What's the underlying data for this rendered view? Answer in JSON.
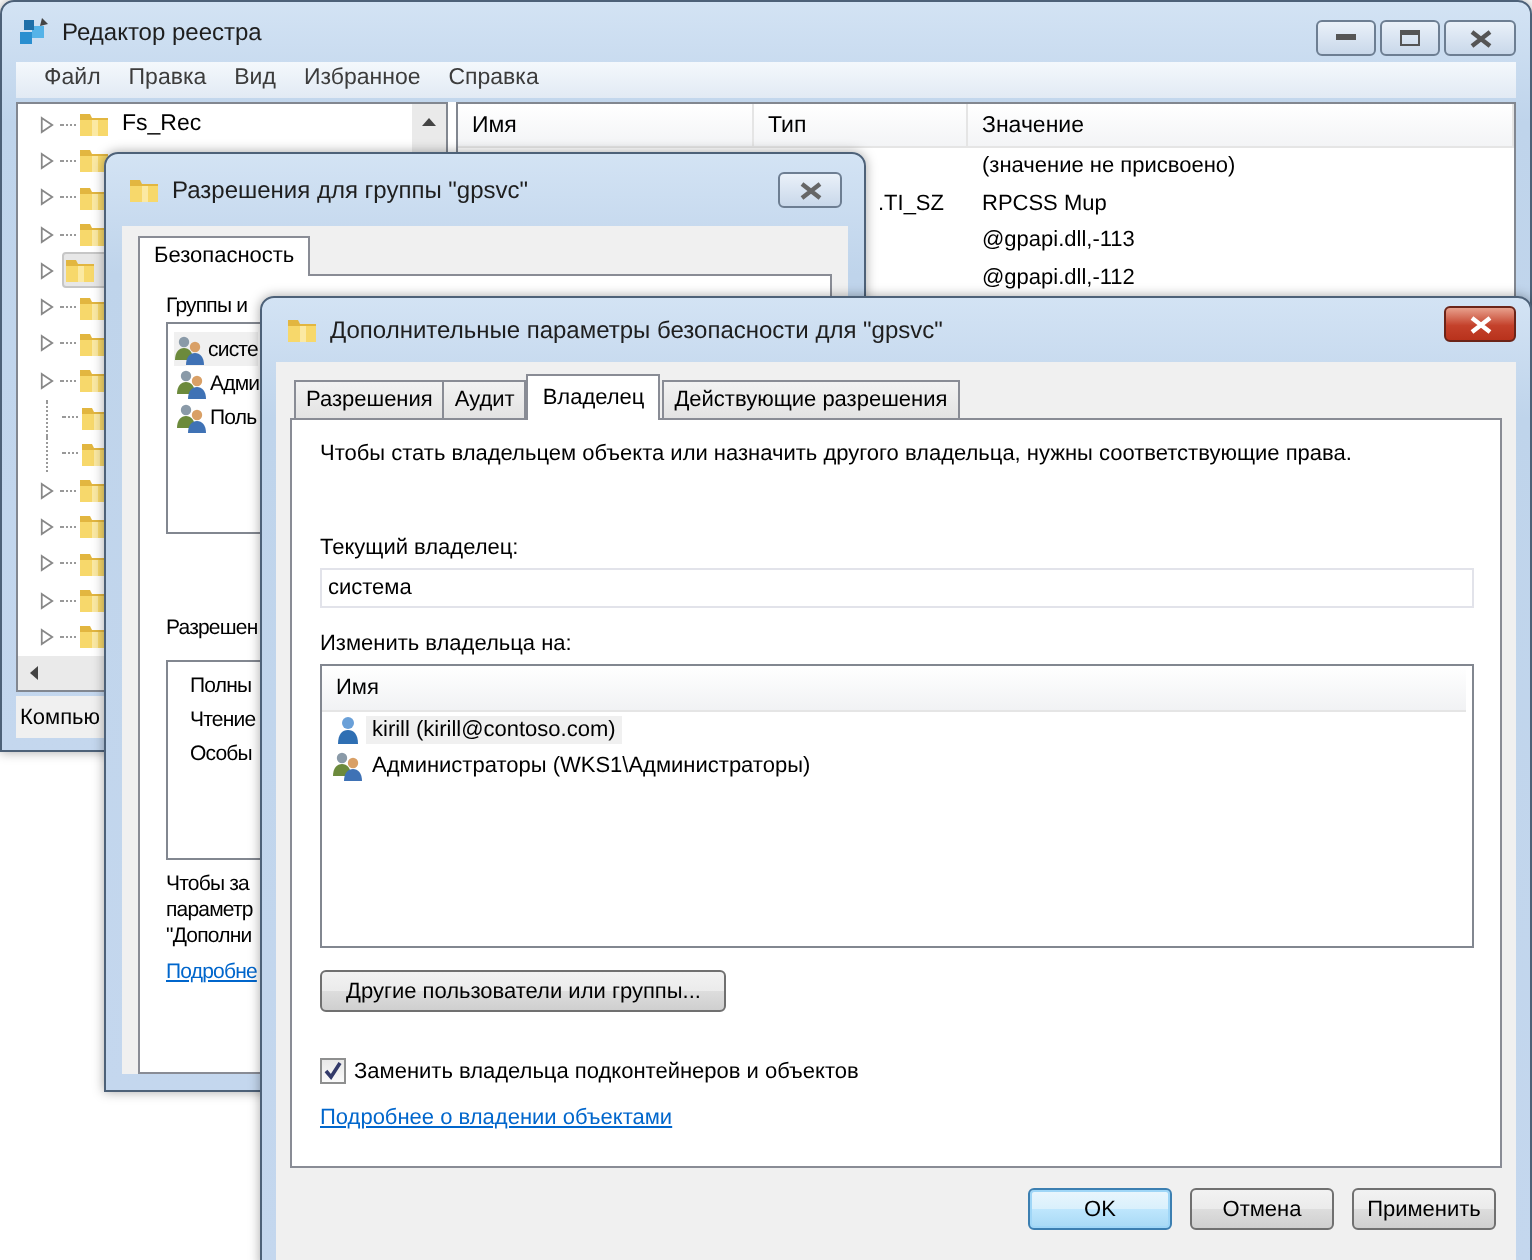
{
  "registry_editor": {
    "title": "Редактор реестра",
    "menu": [
      "Файл",
      "Правка",
      "Вид",
      "Избранное",
      "Справка"
    ],
    "tree": [
      {
        "label": "Fs_Rec",
        "expandable": true,
        "selected": false
      },
      {
        "expandable": true,
        "selected": false
      },
      {
        "expandable": true,
        "selected": false
      },
      {
        "expandable": true,
        "selected": false
      },
      {
        "expandable": true,
        "selected": true
      },
      {
        "expandable": true,
        "selected": false
      },
      {
        "expandable": true,
        "selected": false
      },
      {
        "expandable": true,
        "selected": false
      },
      {
        "expandable": false,
        "selected": false
      },
      {
        "expandable": false,
        "selected": false
      },
      {
        "expandable": true,
        "selected": false
      },
      {
        "expandable": true,
        "selected": false
      },
      {
        "expandable": true,
        "selected": false
      },
      {
        "expandable": true,
        "selected": false
      },
      {
        "expandable": true,
        "selected": false
      }
    ],
    "columns": [
      "Имя",
      "Тип",
      "Значение"
    ],
    "rows": [
      {
        "value": "(значение не присвоено)"
      },
      {
        "type": ".TI_SZ",
        "value": "RPCSS Mup"
      },
      {
        "value": "@gpapi.dll,-113"
      },
      {
        "value": "@gpapi.dll,-112"
      }
    ],
    "status_bar": "Компью"
  },
  "permissions_dialog": {
    "title": "Разрешения для группы \"gpsvc\"",
    "tab": "Безопасность",
    "groups_label": "Группы и",
    "groups": [
      {
        "name": "систе",
        "selected": true
      },
      {
        "name": "Адми",
        "selected": false
      },
      {
        "name": "Поль",
        "selected": false
      }
    ],
    "permissions_label": "Разрешен",
    "permissions": [
      "Полны",
      "Чтение",
      "Особы"
    ],
    "note": "Чтобы за\nпараметр\n\"Дополни",
    "link": "Подробне"
  },
  "advanced_dialog": {
    "title": "Дополнительные параметры безопасности  для \"gpsvc\"",
    "tabs": [
      {
        "label": "Разрешения",
        "selected": false
      },
      {
        "label": "Аудит",
        "selected": false
      },
      {
        "label": "Владелец",
        "selected": true
      },
      {
        "label": "Действующие разрешения",
        "selected": false
      }
    ],
    "description": "Чтобы стать владельцем объекта или назначить другого владельца, нужны соответствующие права.",
    "current_owner_label": "Текущий владелец:",
    "current_owner": "система",
    "change_owner_label": "Изменить владельца на:",
    "owners_column": "Имя",
    "owners": [
      {
        "name": "kirill (kirill@contoso.com)",
        "kind": "user",
        "selected": true
      },
      {
        "name": "Администраторы (WKS1\\Администраторы)",
        "kind": "group",
        "selected": false
      }
    ],
    "other_button": "Другие пользователи или группы...",
    "replace_checkbox": {
      "label": "Заменить владельца подконтейнеров и объектов",
      "checked": true
    },
    "link": "Подробнее о владении объектами",
    "buttons": [
      {
        "label": "OK",
        "default": true
      },
      {
        "label": "Отмена",
        "default": false
      },
      {
        "label": "Применить",
        "default": false
      }
    ]
  }
}
